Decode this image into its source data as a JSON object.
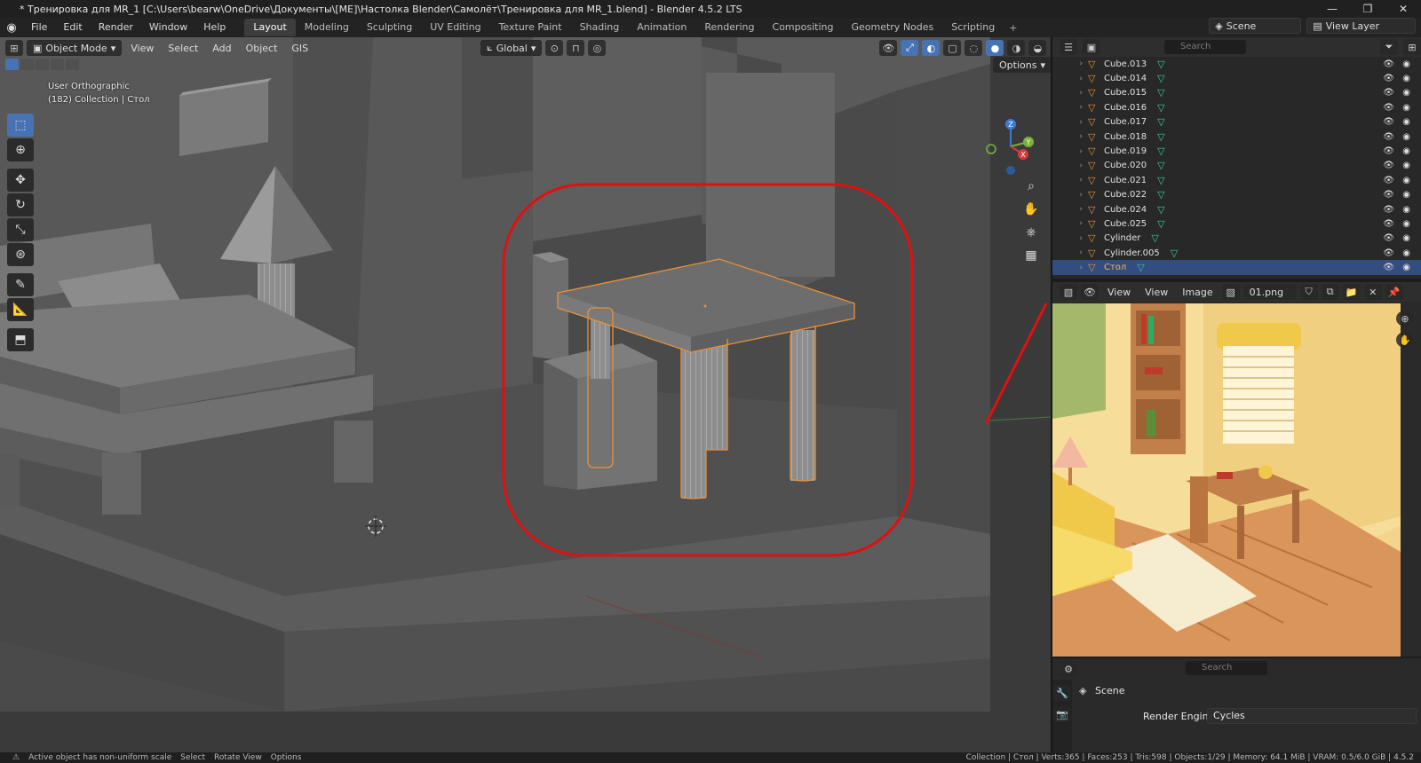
{
  "window": {
    "title": "* Тренировка для MR_1 [C:\\Users\\bearw\\OneDrive\\Документы\\[ME]\\Настолка Blender\\Самолёт\\Тренировка для MR_1.blend] - Blender 4.5.2 LTS",
    "minimize": "—",
    "maximize": "❐",
    "close": "✕"
  },
  "menu": {
    "items": [
      "File",
      "Edit",
      "Render",
      "Window",
      "Help"
    ],
    "workspaces": [
      "Layout",
      "Modeling",
      "Sculpting",
      "UV Editing",
      "Texture Paint",
      "Shading",
      "Animation",
      "Rendering",
      "Compositing",
      "Geometry Nodes",
      "Scripting"
    ],
    "active_workspace": "Layout",
    "scene": "Scene",
    "view_layer": "View Layer"
  },
  "viewport": {
    "mode": "Object Mode",
    "menus": [
      "View",
      "Select",
      "Add",
      "Object",
      "GIS"
    ],
    "orientation": "Global",
    "options": "Options",
    "view_name": "User Orthographic",
    "collection_info": "(182) Collection | Стол",
    "gizmo": {
      "x": "X",
      "y": "Y",
      "z": "Z"
    }
  },
  "outliner": {
    "search_placeholder": "Search",
    "rows": [
      {
        "name": "Cube.013",
        "selected": false
      },
      {
        "name": "Cube.014",
        "selected": false
      },
      {
        "name": "Cube.015",
        "selected": false
      },
      {
        "name": "Cube.016",
        "selected": false
      },
      {
        "name": "Cube.017",
        "selected": false
      },
      {
        "name": "Cube.018",
        "selected": false
      },
      {
        "name": "Cube.019",
        "selected": false
      },
      {
        "name": "Cube.020",
        "selected": false
      },
      {
        "name": "Cube.021",
        "selected": false
      },
      {
        "name": "Cube.022",
        "selected": false
      },
      {
        "name": "Cube.024",
        "selected": false
      },
      {
        "name": "Cube.025",
        "selected": false
      },
      {
        "name": "Cylinder",
        "selected": false
      },
      {
        "name": "Cylinder.005",
        "selected": false
      },
      {
        "name": "Стол",
        "selected": true
      }
    ]
  },
  "image_editor": {
    "menus": [
      "View",
      "View",
      "Image"
    ],
    "image_name": "01.png"
  },
  "properties": {
    "search_placeholder": "Search",
    "scene_label": "Scene",
    "render_engine_label": "Render Engine",
    "render_engine_value": "Cycles"
  },
  "status": {
    "warning": "Active object has non-uniform scale",
    "select": "Select",
    "rotate": "Rotate View",
    "options": "Options",
    "stats": "Collection | Стол | Verts:365 | Faces:253 | Tris:598 | Objects:1/29 | Memory: 64.1 MiB | VRAM: 0.5/6.0 GiB |",
    "version": "4.5.2"
  },
  "colors": {
    "selection_orange": "#e8913a",
    "annotation_red": "#e01010",
    "accent_blue": "#4772b3"
  }
}
